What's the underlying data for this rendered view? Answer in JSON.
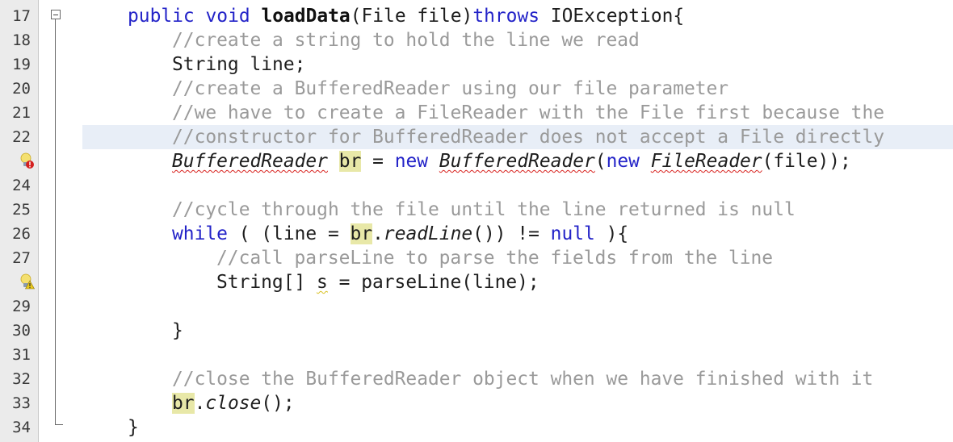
{
  "editor": {
    "highlighted_line": 22,
    "lines": [
      {
        "num": "17",
        "segments": [
          {
            "t": "public",
            "c": "kw"
          },
          {
            "t": " "
          },
          {
            "t": "void",
            "c": "kw"
          },
          {
            "t": " "
          },
          {
            "t": "loadData",
            "c": "bold"
          },
          {
            "t": "(File file)"
          },
          {
            "t": "throws",
            "c": "kw"
          },
          {
            "t": " IOException{"
          }
        ],
        "indent": 0
      },
      {
        "num": "18",
        "segments": [
          {
            "t": "//create a string to hold the line we read",
            "c": "cm"
          }
        ],
        "indent": 1
      },
      {
        "num": "19",
        "segments": [
          {
            "t": "String line;"
          }
        ],
        "indent": 1
      },
      {
        "num": "20",
        "segments": [
          {
            "t": "//create a BufferedReader using our file parameter",
            "c": "cm"
          }
        ],
        "indent": 1
      },
      {
        "num": "21",
        "segments": [
          {
            "t": "//we have to create a FileReader with the File first because the",
            "c": "cm"
          }
        ],
        "indent": 1
      },
      {
        "num": "22",
        "segments": [
          {
            "t": "//constructor for BufferedReader does not accept a File directly",
            "c": "cm"
          }
        ],
        "indent": 1
      },
      {
        "num": "",
        "segments": [
          {
            "t": "BufferedReader",
            "c": "it err"
          },
          {
            "t": " "
          },
          {
            "t": "br",
            "c": "mark"
          },
          {
            "t": " = "
          },
          {
            "t": "new",
            "c": "kw"
          },
          {
            "t": " "
          },
          {
            "t": "BufferedReader",
            "c": "it err"
          },
          {
            "t": "("
          },
          {
            "t": "new",
            "c": "kw"
          },
          {
            "t": " "
          },
          {
            "t": "FileReader",
            "c": "it err"
          },
          {
            "t": "(file));"
          }
        ],
        "indent": 1,
        "icon": "error-hint-bulb"
      },
      {
        "num": "24",
        "segments": [],
        "indent": 1
      },
      {
        "num": "25",
        "segments": [
          {
            "t": "//cycle through the file until the line returned is null",
            "c": "cm"
          }
        ],
        "indent": 1
      },
      {
        "num": "26",
        "segments": [
          {
            "t": "while",
            "c": "kw"
          },
          {
            "t": " ( (line = "
          },
          {
            "t": "br",
            "c": "mark"
          },
          {
            "t": "."
          },
          {
            "t": "readLine",
            "c": "it"
          },
          {
            "t": "()) != "
          },
          {
            "t": "null",
            "c": "kw"
          },
          {
            "t": " ){"
          }
        ],
        "indent": 1
      },
      {
        "num": "27",
        "segments": [
          {
            "t": "//call parseLine to parse the fields from the line",
            "c": "cm"
          }
        ],
        "indent": 2
      },
      {
        "num": "",
        "segments": [
          {
            "t": "String[] "
          },
          {
            "t": "s",
            "c": "warn"
          },
          {
            "t": " = parseLine(line);"
          }
        ],
        "indent": 2,
        "icon": "warning-hint-bulb"
      },
      {
        "num": "29",
        "segments": [],
        "indent": 2
      },
      {
        "num": "30",
        "segments": [
          {
            "t": "}"
          }
        ],
        "indent": 1
      },
      {
        "num": "31",
        "segments": [],
        "indent": 1
      },
      {
        "num": "32",
        "segments": [
          {
            "t": "//close the BufferedReader object when we have finished with it",
            "c": "cm"
          }
        ],
        "indent": 1
      },
      {
        "num": "33",
        "segments": [
          {
            "t": "br",
            "c": "mark"
          },
          {
            "t": "."
          },
          {
            "t": "close",
            "c": "it"
          },
          {
            "t": "();"
          }
        ],
        "indent": 1
      },
      {
        "num": "34",
        "segments": [
          {
            "t": "}"
          }
        ],
        "indent": 0
      }
    ]
  }
}
